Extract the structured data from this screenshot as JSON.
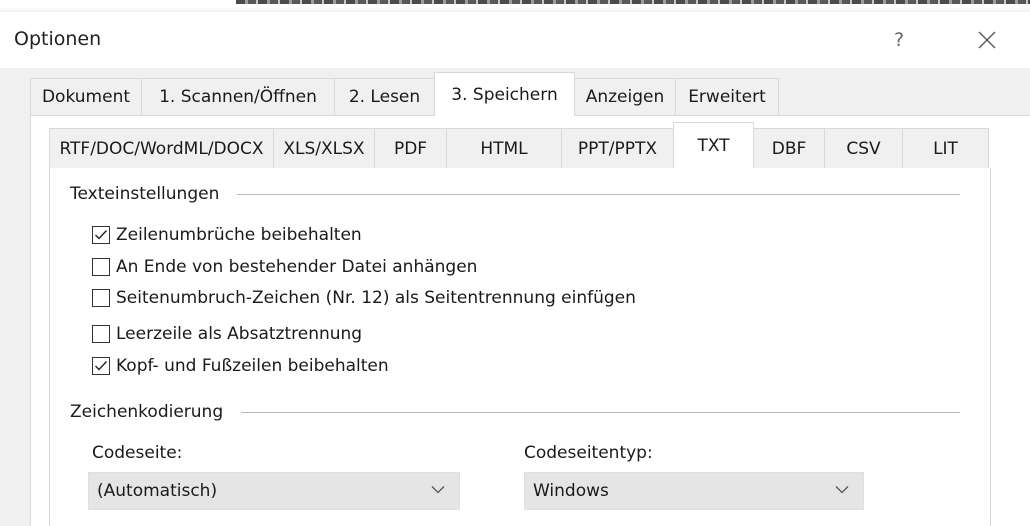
{
  "window": {
    "title": "Optionen",
    "help_label": "?"
  },
  "main_tabs": [
    {
      "label": "Dokument",
      "active": false
    },
    {
      "label": "1. Scannen/Öffnen",
      "active": false
    },
    {
      "label": "2. Lesen",
      "active": false
    },
    {
      "label": "3. Speichern",
      "active": true
    },
    {
      "label": "Anzeigen",
      "active": false
    },
    {
      "label": "Erweitert",
      "active": false
    }
  ],
  "sub_tabs": [
    {
      "label": "RTF/DOC/WordML/DOCX",
      "active": false
    },
    {
      "label": "XLS/XLSX",
      "active": false
    },
    {
      "label": "PDF",
      "active": false
    },
    {
      "label": "HTML",
      "active": false
    },
    {
      "label": "PPT/PPTX",
      "active": false
    },
    {
      "label": "TXT",
      "active": true
    },
    {
      "label": "DBF",
      "active": false
    },
    {
      "label": "CSV",
      "active": false
    },
    {
      "label": "LIT",
      "active": false
    }
  ],
  "text_settings": {
    "header": "Texteinstellungen",
    "options": [
      {
        "label": "Zeilenumbrüche beibehalten",
        "checked": true
      },
      {
        "label": "An Ende von bestehender Datei anhängen",
        "checked": false
      },
      {
        "label": "Seitenumbruch-Zeichen (Nr. 12) als Seitentrennung einfügen",
        "checked": false
      },
      {
        "label": "Leerzeile als Absatztrennung",
        "checked": false
      },
      {
        "label": "Kopf- und Fußzeilen beibehalten",
        "checked": true
      }
    ]
  },
  "encoding": {
    "header": "Zeichenkodierung",
    "codepage_label": "Codeseite:",
    "codepage_value": "(Automatisch)",
    "codepage_type_label": "Codeseitentyp:",
    "codepage_type_value": "Windows"
  },
  "colors": {
    "dialog_bg": "#f0f0f0",
    "panel_bg": "#ffffff",
    "select_bg": "#e5e5e5",
    "tab_border": "#d9d9d9"
  },
  "icons": {
    "close": "close-icon",
    "check": "check-icon",
    "dropdown": "chevron-down-icon"
  }
}
